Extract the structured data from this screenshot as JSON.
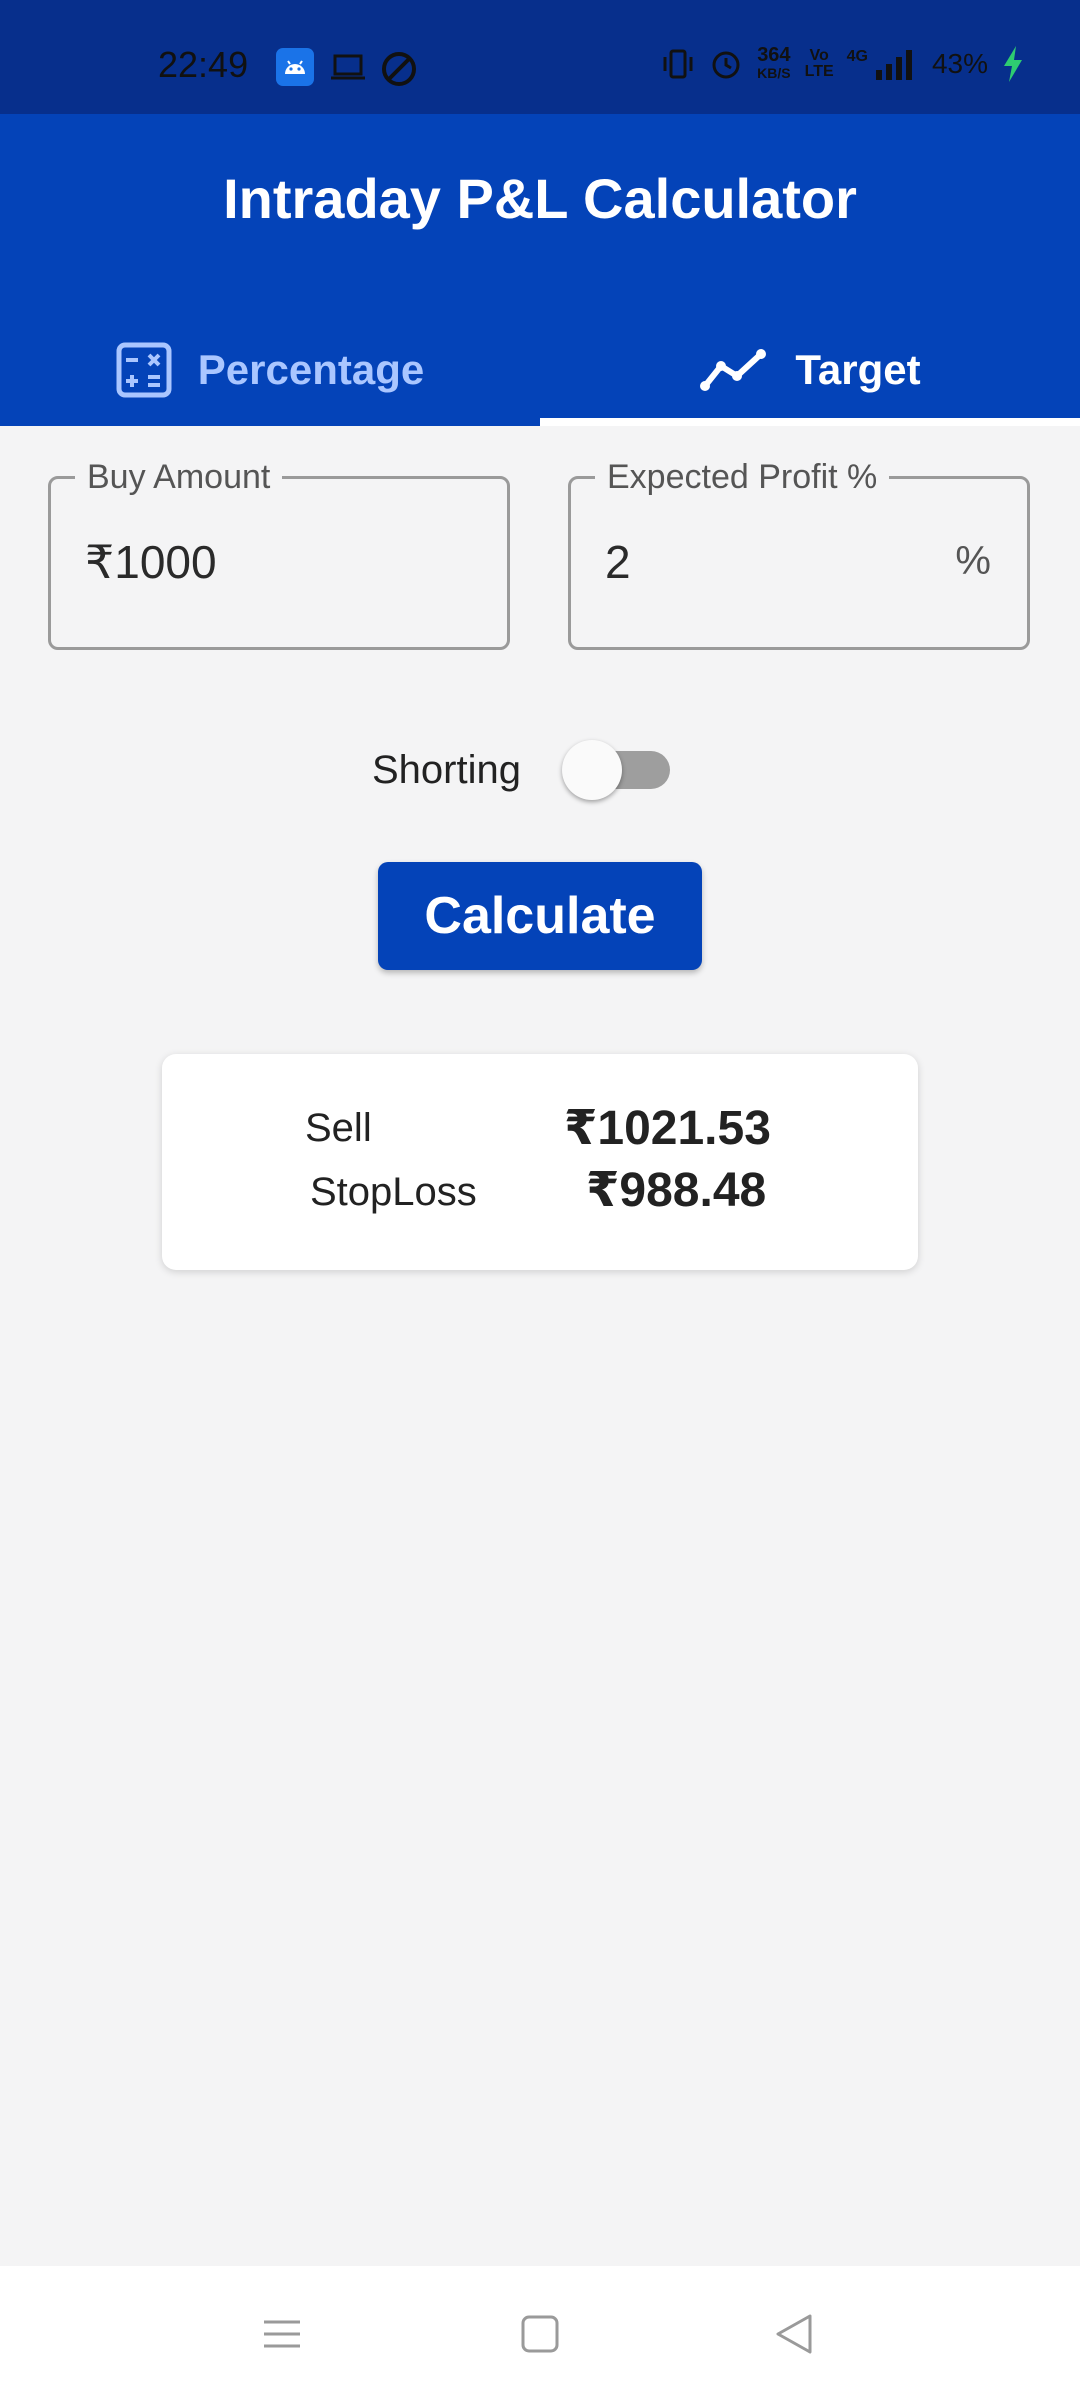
{
  "status_bar": {
    "time": "22:49",
    "network_speed_top": "364",
    "network_speed_unit": "KB/S",
    "volte_label": "Vo LTE",
    "network_type": "4G",
    "battery_percent": "43%"
  },
  "app_bar": {
    "title": "Intraday P&L Calculator"
  },
  "tabs": [
    {
      "label": "Percentage",
      "icon": "calculator-icon",
      "selected": false
    },
    {
      "label": "Target",
      "icon": "trending-up-icon",
      "selected": true
    }
  ],
  "form": {
    "buy_amount": {
      "label": "Buy Amount",
      "value": "₹1000"
    },
    "expected_profit": {
      "label": "Expected Profit %",
      "value": "2",
      "suffix": "%"
    },
    "shorting": {
      "label": "Shorting",
      "enabled": false
    },
    "calculate_label": "Calculate"
  },
  "result": {
    "sell_label": "Sell",
    "sell_value": "₹1021.53",
    "stoploss_label": "StopLoss",
    "stoploss_value": "₹988.48"
  },
  "colors": {
    "primary": "#0443b8",
    "status_bar": "#072f8c",
    "background": "#f4f4f5"
  }
}
